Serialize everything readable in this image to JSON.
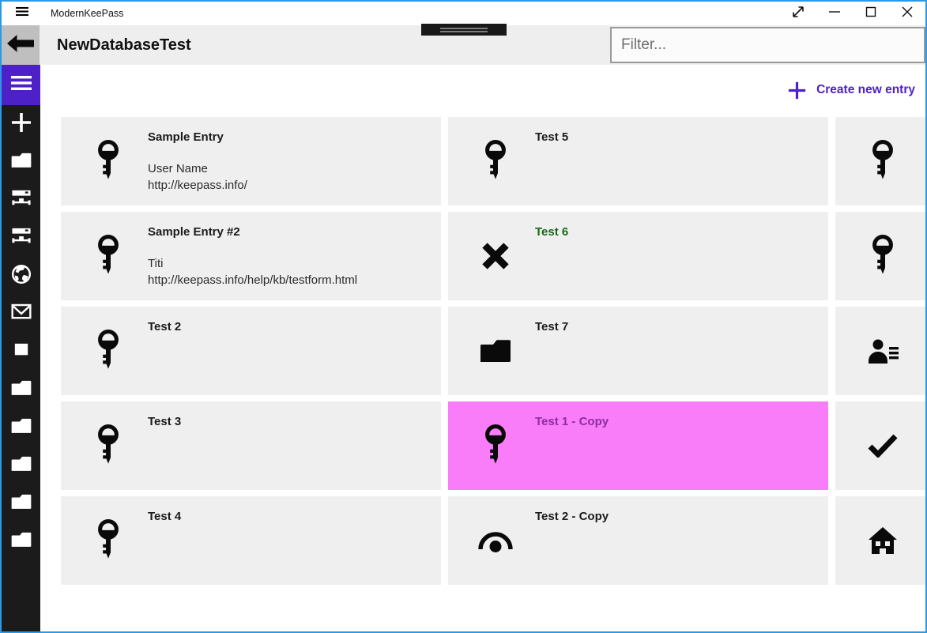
{
  "titlebar": {
    "app_title": "ModernKeePass",
    "menu_icon": "hamburger",
    "controls": [
      {
        "icon": "resize"
      },
      {
        "icon": "minimize"
      },
      {
        "icon": "maximize"
      },
      {
        "icon": "close"
      }
    ]
  },
  "header": {
    "title": "NewDatabaseTest",
    "back_icon": "back",
    "filter_placeholder": "Filter..."
  },
  "sidebar": {
    "items": [
      {
        "icon": "hamburger"
      },
      {
        "icon": "plus"
      },
      {
        "icon": "folder"
      },
      {
        "icon": "network"
      },
      {
        "icon": "network"
      },
      {
        "icon": "globe"
      },
      {
        "icon": "mail"
      },
      {
        "icon": "square"
      },
      {
        "icon": "folder"
      },
      {
        "icon": "folder"
      },
      {
        "icon": "folder"
      },
      {
        "icon": "folder"
      },
      {
        "icon": "folder"
      }
    ]
  },
  "toolbar": {
    "create_label": "Create new entry",
    "create_icon": "plus"
  },
  "entries": [
    {
      "title": "Sample Entry",
      "line1": "User Name",
      "line2": "http://keepass.info/",
      "icon": "key",
      "bg": "#EFEFEF",
      "title_color": "#1B1B1B"
    },
    {
      "title": "Test 5",
      "icon": "key",
      "bg": "#EFEFEF",
      "title_color": "#1B1B1B"
    },
    {
      "title": "",
      "icon": "key",
      "bg": "#EFEFEF",
      "title_color": "#1B1B1B"
    },
    {
      "title": "Sample Entry #2",
      "line1": "Titi",
      "line2": "http://keepass.info/help/kb/testform.html",
      "icon": "key",
      "bg": "#EFEFEF",
      "title_color": "#1B1B1B"
    },
    {
      "title": "Test 6",
      "icon": "x",
      "bg": "#EFEFEF",
      "title_color": "#176917"
    },
    {
      "title": "",
      "icon": "key",
      "bg": "#EFEFEF",
      "title_color": "#1B1B1B"
    },
    {
      "title": "Test 2",
      "icon": "key",
      "bg": "#EFEFEF",
      "title_color": "#1B1B1B"
    },
    {
      "title": "Test 7",
      "icon": "folder",
      "bg": "#EFEFEF",
      "title_color": "#1B1B1B"
    },
    {
      "title": "",
      "icon": "contact",
      "bg": "#EFEFEF",
      "title_color": "#1B1B1B"
    },
    {
      "title": "Test 3",
      "icon": "key",
      "bg": "#EFEFEF",
      "title_color": "#1B1B1B"
    },
    {
      "title": "Test 1 - Copy",
      "icon": "key",
      "bg": "#F97CF9",
      "title_color": "#8C2DA2",
      "selected": true
    },
    {
      "title": "",
      "icon": "check",
      "bg": "#EFEFEF",
      "title_color": "#1B1B1B"
    },
    {
      "title": "Test 4",
      "icon": "key",
      "bg": "#EFEFEF",
      "title_color": "#1B1B1B"
    },
    {
      "title": "Test 2 - Copy",
      "icon": "view",
      "bg": "#EFEFEF",
      "title_color": "#1B1B1B"
    },
    {
      "title": "",
      "icon": "home",
      "bg": "#EFEFEF",
      "title_color": "#1B1B1B"
    }
  ],
  "colors": {
    "accent": "#4E21C8",
    "window_border": "#2B99E8",
    "selected_bg": "#F97CF9",
    "selected_title": "#8C2DA2",
    "green_title": "#176917"
  }
}
